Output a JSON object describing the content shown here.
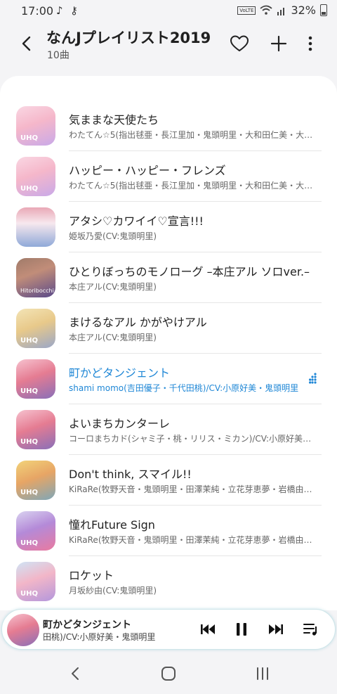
{
  "status_bar": {
    "time": "17:00",
    "battery": "32%",
    "volte": "VoLTE"
  },
  "header": {
    "title": "なんJプレイリスト2019",
    "count": "10曲"
  },
  "tracks": [
    {
      "title": "気ままな天使たち",
      "artist": "わたてん☆5(指出毬亜・長江里加・鬼頭明里・大和田仁美・大…",
      "badge": "UHQ"
    },
    {
      "title": "ハッピー・ハッピー・フレンズ",
      "artist": "わたてん☆5(指出毬亜・長江里加・鬼頭明里・大和田仁美・大…",
      "badge": "UHQ"
    },
    {
      "title": "アタシ♡カワイイ♡宣言!!!",
      "artist": "姫坂乃愛(CV:鬼頭明里)",
      "badge": ""
    },
    {
      "title": "ひとりぼっちのモノローグ –本庄アル ソロver.–",
      "artist": "本庄アル(CV:鬼頭明里)",
      "badge": "",
      "art_text": "Hitoribocchi"
    },
    {
      "title": "まけるなアル かがやけアル",
      "artist": "本庄アル(CV:鬼頭明里)",
      "badge": "UHQ"
    },
    {
      "title": "町かどタンジェント",
      "artist": "shami momo(吉田優子・千代田桃)/CV:小原好美・鬼頭明里",
      "badge": "UHQ",
      "active": true
    },
    {
      "title": "よいまちカンターレ",
      "artist": "コーロまちカド(シャミ子・桃・リリス・ミカン)/CV:小原好美・鬼頭…",
      "badge": "UHQ"
    },
    {
      "title": "Don't think, スマイル!!",
      "artist": "KiRaRe(牧野天音・鬼頭明里・田澤茉純・立花芽恵夢・岩橋由…",
      "badge": "UHQ"
    },
    {
      "title": "憧れFuture Sign",
      "artist": "KiRaRe(牧野天音・鬼頭明里・田澤茉純・立花芽恵夢・岩橋由…",
      "badge": "UHQ"
    },
    {
      "title": "ロケット",
      "artist": "月坂紗由(CV:鬼頭明里)",
      "badge": "UHQ"
    }
  ],
  "player": {
    "title": "町かどタンジェント",
    "artist": "田桃)/CV:小原好美・鬼頭明里"
  },
  "colors": {
    "accent": "#1f87d6"
  }
}
